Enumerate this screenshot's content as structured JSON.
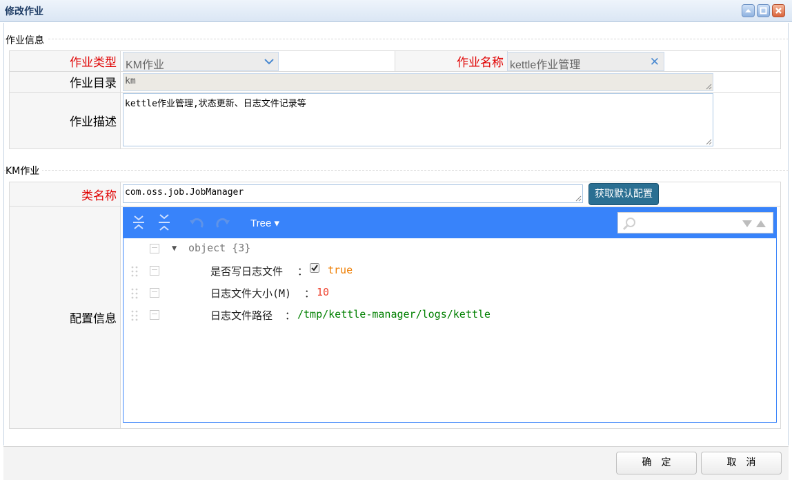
{
  "window": {
    "title": "修改作业"
  },
  "section_job_info": {
    "legend": "作业信息"
  },
  "fields": {
    "job_type": {
      "label": "作业类型",
      "value": "KM作业"
    },
    "job_name": {
      "label": "作业名称",
      "value": "kettle作业管理"
    },
    "job_dir": {
      "label": "作业目录",
      "value": "km"
    },
    "job_desc": {
      "label": "作业描述",
      "value": "kettle作业管理,状态更新、日志文件记录等"
    }
  },
  "section_km": {
    "legend": "KM作业"
  },
  "km": {
    "class_label": "类名称",
    "class_value": "com.oss.job.JobManager",
    "get_default_button": "获取默认配置",
    "config_label": "配置信息"
  },
  "json_editor": {
    "mode_label": "Tree ▾",
    "root": "object {3}",
    "rows": [
      {
        "key": "是否写日志文件",
        "sep": "：",
        "value": "true",
        "type": "boolean",
        "checked": true
      },
      {
        "key": "日志文件大小(M)",
        "sep": "：",
        "value": "10",
        "type": "number"
      },
      {
        "key": "日志文件路径",
        "sep": "：",
        "value": "/tmp/kettle-manager/logs/kettle",
        "type": "string"
      }
    ]
  },
  "footer": {
    "ok": "确定",
    "cancel": "取消"
  },
  "colors": {
    "required": "#e00000",
    "editor_menu": "#3883fa",
    "boolean": "#ee7d00",
    "number": "#ee422e",
    "string": "#008000"
  }
}
